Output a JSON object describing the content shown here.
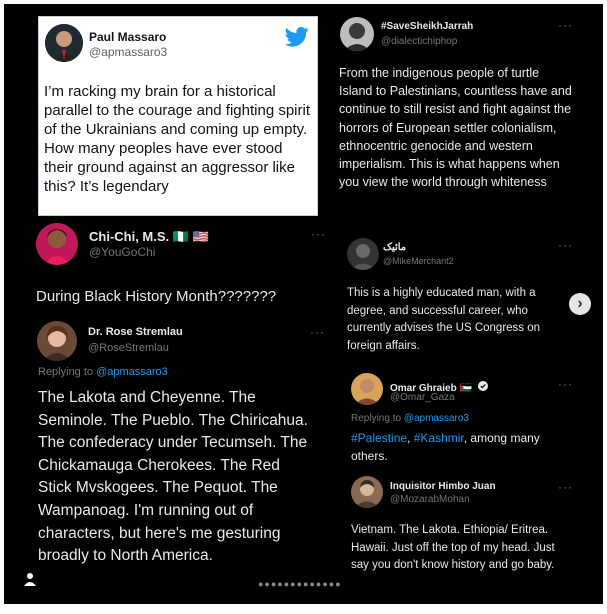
{
  "pm": {
    "name": "Paul Massaro",
    "handle": "@apmassaro3",
    "body": "I’m racking my brain for a historical parallel to the courage and fighting spirit of the Ukrainians and coming up empty. How many peoples have ever stood their ground against an aggressor like this? It’s legendary"
  },
  "chichi": {
    "name": "Chi-Chi, M.S. 🇳🇬 🇺🇸",
    "handle": "@YouGoChi",
    "body": "During Black History Month???????"
  },
  "rose": {
    "name": "Dr. Rose Stremlau",
    "handle": "@RoseStremlau",
    "replying_prefix": "Replying to ",
    "replying_handle": "@apmassaro3",
    "body": "The Lakota and Cheyenne. The Seminole. The Pueblo. The Chiricahua. The confederacy under Tecumseh. The Chickamauga Cherokees. The Red Stick Mvskogees. The Pequot. The Wampanoag. I'm running out of characters, but here's me gesturing broadly to North America."
  },
  "ssj": {
    "name": "#SaveSheikhJarrah",
    "handle": "@dialectichiphop",
    "body": "From the indigenous people of turtle Island to Palestinians, countless have and continue to still resist and fight against the horrors of European settler colonialism, ethnocentric genocide and western imperialism. This is what happens when you view the world through whiteness"
  },
  "mike": {
    "name": "مائیک",
    "handle": "@MikeMerchant2",
    "body": "This is a highly educated man, with a degree, and successful career, who currently advises the US Congress on foreign affairs."
  },
  "omar": {
    "name": "Omar Ghraieb 🇵🇸",
    "handle": "@Omar_Gaza",
    "replying_prefix": "Replying to ",
    "replying_handle": "@apmassaro3",
    "tag1": "#Palestine",
    "sep": ", ",
    "tag2": "#Kashmir",
    "body_rest": ", among many others."
  },
  "himbo": {
    "name": "Inquisitor Himbo Juan",
    "handle": "@MozarabMohan",
    "body": "Vietnam. The Lakota. Ethiopia/ Eritrea. Hawaii. Just off the top of my head. Just say you don't know history and go baby."
  },
  "ui": {
    "more": "···",
    "next": "›",
    "pager": "●●●●●●●●●●●●●"
  },
  "colors": {
    "twitter_blue": "#1d9bf0",
    "background": "#000000"
  },
  "icons": [
    "twitter-bird-icon",
    "verified-badge-icon",
    "person-icon",
    "chevron-right-icon"
  ]
}
